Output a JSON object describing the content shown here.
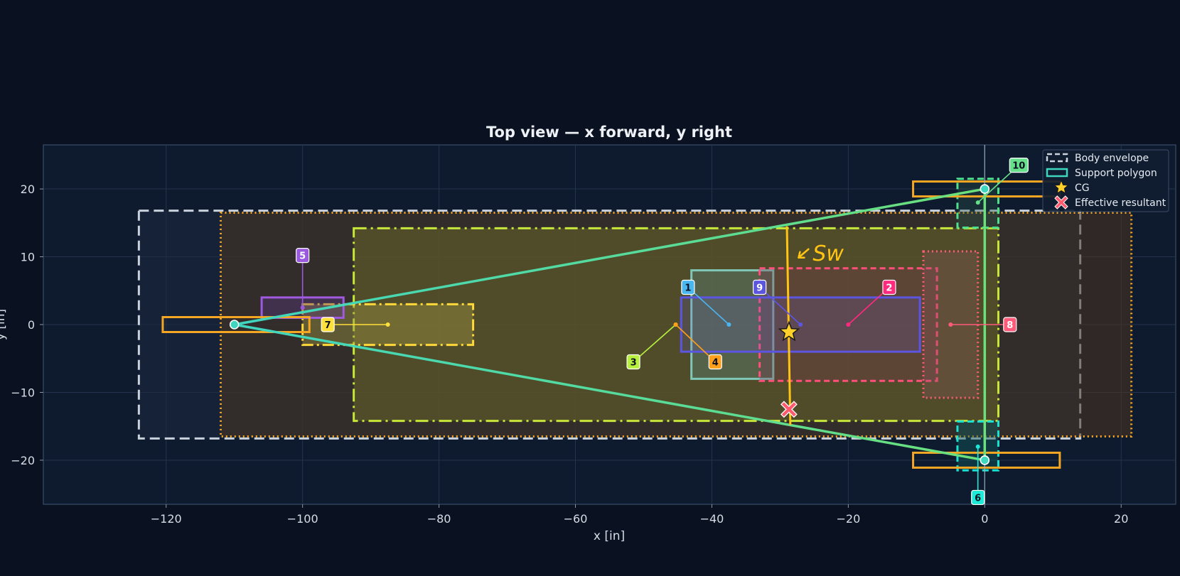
{
  "chart_data": {
    "type": "scatter",
    "title": "Top view — x forward, y right",
    "xlabel": "x [in]",
    "ylabel": "y [in]",
    "xlim": [
      -138,
      28
    ],
    "ylim": [
      -26.5,
      26.5
    ],
    "xticks": [
      -120,
      -100,
      -80,
      -60,
      -40,
      -20,
      0,
      20
    ],
    "yticks": [
      -20,
      -10,
      0,
      10,
      20
    ],
    "grid": true,
    "legend_position": "top-right",
    "legend": [
      {
        "label": "Body envelope",
        "key": "body"
      },
      {
        "label": "Support polygon",
        "key": "support"
      },
      {
        "label": "CG",
        "key": "cg"
      },
      {
        "label": "Effective resultant",
        "key": "resultant"
      }
    ],
    "regions": [
      {
        "key": "body-envelope",
        "x0": -124,
        "x1": 14,
        "y0": -16.8,
        "y1": 16.8,
        "stroke": "#c9d1dc",
        "fill": "#1b2940",
        "fill_opacity": 0.55,
        "dash": "14 7",
        "width": 3
      },
      {
        "key": "outer-envelope",
        "x0": -112,
        "x1": 21.5,
        "y0": -16.5,
        "y1": 16.5,
        "stroke": "#f5a623",
        "fill": "#4a3520",
        "fill_opacity": 0.55,
        "dash": "2 4",
        "width": 3
      },
      {
        "key": "cargo-zone",
        "x0": -92.5,
        "x1": 2,
        "y0": -14.2,
        "y1": 14.2,
        "stroke": "#c6e63a",
        "fill": "#8a8a28",
        "fill_opacity": 0.35,
        "dash": "18 6 3 6",
        "width": 3
      },
      {
        "key": "component-1",
        "x0": -43,
        "x1": -31,
        "y0": -8,
        "y1": 8,
        "stroke": "#7fc8b8",
        "fill": "#5b8c86",
        "fill_opacity": 0.35,
        "dash": "",
        "width": 3
      },
      {
        "key": "component-2",
        "x0": -33,
        "x1": -7,
        "y0": -8.3,
        "y1": 8.3,
        "stroke": "#ff4f7a",
        "fill": "#7a3550",
        "fill_opacity": 0.3,
        "dash": "8 5",
        "width": 3
      },
      {
        "key": "component-9",
        "x0": -44.5,
        "x1": -9.5,
        "y0": -4,
        "y1": 4,
        "stroke": "#5b55e0",
        "fill": "#6a5ad8",
        "fill_opacity": 0.18,
        "dash": "",
        "width": 3
      },
      {
        "key": "component-8",
        "x0": -9,
        "x1": -1,
        "y0": -10.8,
        "y1": 10.8,
        "stroke": "#ff5a7a",
        "fill": "#8a5560",
        "fill_opacity": 0.3,
        "dash": "2 4",
        "width": 3
      },
      {
        "key": "component-7",
        "x0": -100,
        "x1": -75,
        "y0": -3,
        "y1": 3,
        "stroke": "#ffd83a",
        "fill": "#9a9240",
        "fill_opacity": 0.45,
        "dash": "16 5 3 5",
        "width": 3
      },
      {
        "key": "component-5",
        "x0": -106,
        "x1": -94,
        "y0": 1,
        "y1": 4,
        "stroke": "#a05ae0",
        "fill": "#5a3a80",
        "fill_opacity": 0.4,
        "dash": "",
        "width": 3
      },
      {
        "key": "component-10",
        "x0": -4,
        "x1": 2,
        "y0": 14.3,
        "y1": 21.5,
        "stroke": "#4ee08a",
        "fill": "#2a5a4a",
        "fill_opacity": 0.35,
        "dash": "9 5",
        "width": 3
      },
      {
        "key": "component-6",
        "x0": -4,
        "x1": 2,
        "y0": -21.5,
        "y1": -14.3,
        "stroke": "#19e0d0",
        "fill": "#0f5a5a",
        "fill_opacity": 0.45,
        "dash": "9 5",
        "width": 3
      },
      {
        "key": "pad-rear",
        "x0": -120.5,
        "x1": -99,
        "y0": -1.1,
        "y1": 1.1,
        "stroke": "#f5a623",
        "fill": "none",
        "fill_opacity": 0,
        "dash": "",
        "width": 3
      },
      {
        "key": "pad-front-left",
        "x0": -10.5,
        "x1": 11,
        "y0": 18.9,
        "y1": 21.1,
        "stroke": "#f5a623",
        "fill": "none",
        "fill_opacity": 0,
        "dash": "",
        "width": 3
      },
      {
        "key": "pad-front-right",
        "x0": -10.5,
        "x1": 11,
        "y0": -21.1,
        "y1": -18.9,
        "stroke": "#f5a623",
        "fill": "none",
        "fill_opacity": 0,
        "dash": "",
        "width": 3
      }
    ],
    "support_polygon": [
      [
        -110,
        0
      ],
      [
        0,
        20
      ],
      [
        0,
        -20
      ]
    ],
    "support_stroke": "#3fd6c0",
    "support_stroke_end": "#6ce07a",
    "reference_line_x": 0,
    "sw_line": {
      "points": [
        [
          -29,
          14.5
        ],
        [
          -28.5,
          -14.8
        ]
      ],
      "color": "#ffc414"
    },
    "sw_annotation": {
      "text": "Sw",
      "x": -25,
      "y": 10.5,
      "color": "#ffc414"
    },
    "cg": {
      "x": -28.7,
      "y": -1.1,
      "color": "#ffd02a"
    },
    "resultant": {
      "x": -28.7,
      "y": -12.5,
      "color": "#ff5a6e"
    },
    "contact_points": [
      {
        "x": -110,
        "y": 0
      },
      {
        "x": 0,
        "y": 20
      },
      {
        "x": 0,
        "y": -20
      }
    ],
    "callouts": [
      {
        "label": "1",
        "lx": -43.5,
        "ly": 5.5,
        "px": -37.5,
        "py": 0,
        "bg": "#4ab6f0",
        "fg": "#0a1120",
        "line": "#4ab6f0"
      },
      {
        "label": "2",
        "lx": -14,
        "ly": 5.5,
        "px": -20,
        "py": 0,
        "bg": "#ff2a7e",
        "fg": "#ffffff",
        "line": "#ff2a7e"
      },
      {
        "label": "3",
        "lx": -51.5,
        "ly": -5.5,
        "px": -45.3,
        "py": 0,
        "bg": "#b8f040",
        "fg": "#0a1120",
        "line": "#b8f040"
      },
      {
        "label": "4",
        "lx": -39.5,
        "ly": -5.5,
        "px": -45.3,
        "py": 0,
        "bg": "#ff9f1c",
        "fg": "#0a1120",
        "line": "#ff9f1c"
      },
      {
        "label": "5",
        "lx": -100,
        "ly": 10.2,
        "px": -100,
        "py": 2.5,
        "bg": "#9b59e0",
        "fg": "#ffffff",
        "line": "#9b59e0"
      },
      {
        "label": "6",
        "lx": -1,
        "ly": -25.5,
        "px": -1,
        "py": -18,
        "bg": "#1de9d6",
        "fg": "#0a1120",
        "line": "#1de9d6"
      },
      {
        "label": "7",
        "lx": -96.3,
        "ly": 0,
        "px": -87.5,
        "py": 0,
        "bg": "#ffe03a",
        "fg": "#0a1120",
        "line": "#ffe03a"
      },
      {
        "label": "8",
        "lx": 3.7,
        "ly": 0,
        "px": -5,
        "py": 0,
        "bg": "#ff5a7a",
        "fg": "#ffffff",
        "line": "#ff5a7a"
      },
      {
        "label": "9",
        "lx": -33,
        "ly": 5.5,
        "px": -27,
        "py": 0,
        "bg": "#5b55e0",
        "fg": "#ffffff",
        "line": "#5b55e0"
      },
      {
        "label": "10",
        "lx": 5,
        "ly": 23.5,
        "px": -1,
        "py": 18,
        "bg": "#66e08a",
        "fg": "#0a1120",
        "line": "#66e08a"
      }
    ]
  }
}
